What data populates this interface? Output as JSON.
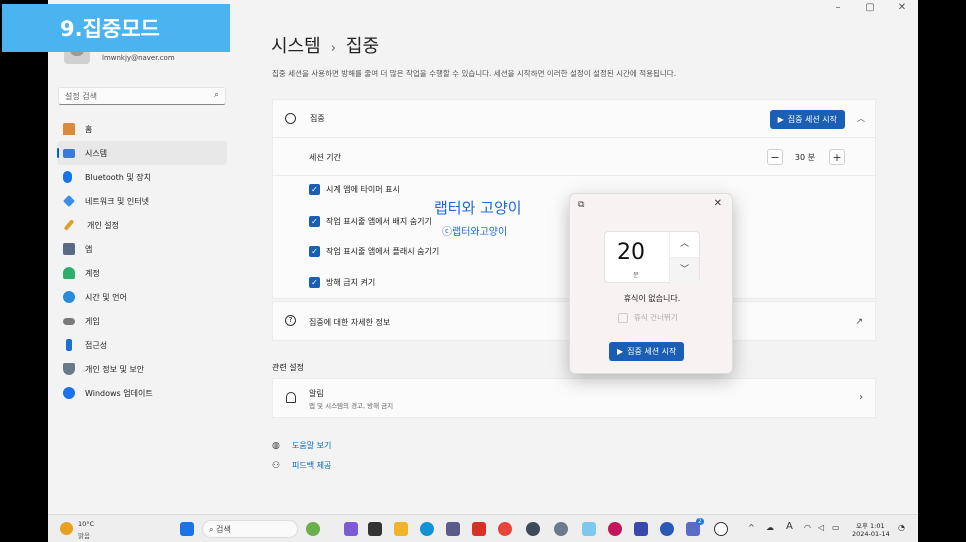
{
  "badge": "9.집중모드",
  "window": {
    "minimize": "–",
    "maximize": "▢",
    "close": "✕"
  },
  "profile": {
    "email": "lmwnkjy@naver.com"
  },
  "search": {
    "placeholder": "설정 검색"
  },
  "nav": {
    "items": [
      {
        "label": "홈",
        "icon": "home-icon",
        "color": "#d98a3a"
      },
      {
        "label": "시스템",
        "icon": "monitor-icon",
        "color": "#3a7bd5"
      },
      {
        "label": "Bluetooth 및 장치",
        "icon": "bluetooth-icon",
        "color": "#1a73e8"
      },
      {
        "label": "네트워크 및 인터넷",
        "icon": "wifi-icon",
        "color": "#3b8ee8"
      },
      {
        "label": "개인 설정",
        "icon": "brush-icon",
        "color": "#e0a030"
      },
      {
        "label": "앱",
        "icon": "apps-icon",
        "color": "#5a6a85"
      },
      {
        "label": "계정",
        "icon": "person-icon",
        "color": "#2fae6a"
      },
      {
        "label": "시간 및 언어",
        "icon": "globe-icon",
        "color": "#2a8bd8"
      },
      {
        "label": "게임",
        "icon": "gamepad-icon",
        "color": "#7a7a7a"
      },
      {
        "label": "접근성",
        "icon": "accessibility-icon",
        "color": "#1a6fd0"
      },
      {
        "label": "개인 정보 및 보안",
        "icon": "shield-icon",
        "color": "#6a7a8a"
      },
      {
        "label": "Windows 업데이트",
        "icon": "update-icon",
        "color": "#1a73e8"
      }
    ]
  },
  "breadcrumb": {
    "parent": "시스템",
    "separator": "›",
    "current": "집중"
  },
  "description": "집중 세션을 사용하면 방해를 줄여 더 많은 작업을 수행할 수 있습니다. 세션을 시작하면 이러한 설정이 설정된 시간에 적용됩니다.",
  "focus": {
    "title": "집중",
    "start_button": "집중 세션 시작",
    "duration_label": "세션 기간",
    "duration_value": "30 분",
    "minus": "−",
    "plus": "+",
    "options": [
      "시계 앱에 타이머 표시",
      "작업 표시줄 앱에서 배지 숨기기",
      "작업 표시줄 앱에서 플래시 숨기기",
      "방해 금지 켜기"
    ]
  },
  "learn_more": "집중에 대한 자세한 정보",
  "related": {
    "title": "관련 설정",
    "notifications": {
      "title": "알림",
      "subtitle": "앱 및 시스템의 경고, 방해 금지"
    }
  },
  "links": {
    "help": "도움말 보기",
    "feedback": "피드백 제공"
  },
  "watermark": {
    "line1": "랩터와 고양이",
    "line2": "ⓒ랩터와고양이"
  },
  "popup": {
    "minutes": "20",
    "unit": "분",
    "break_text": "휴식이 없습니다.",
    "skip_break": "휴식 건너뛰기",
    "start_button": "집중 세션 시작"
  },
  "taskbar": {
    "temp": "10°C",
    "weather": "맑음",
    "search": "검색",
    "time": "오후 1:01",
    "date": "2024-01-14",
    "ime": "A",
    "notification_count": "2"
  },
  "colors": {
    "accent": "#1a5fb4",
    "badge": "#4ab3f0",
    "watermark": "#1a68d6"
  }
}
